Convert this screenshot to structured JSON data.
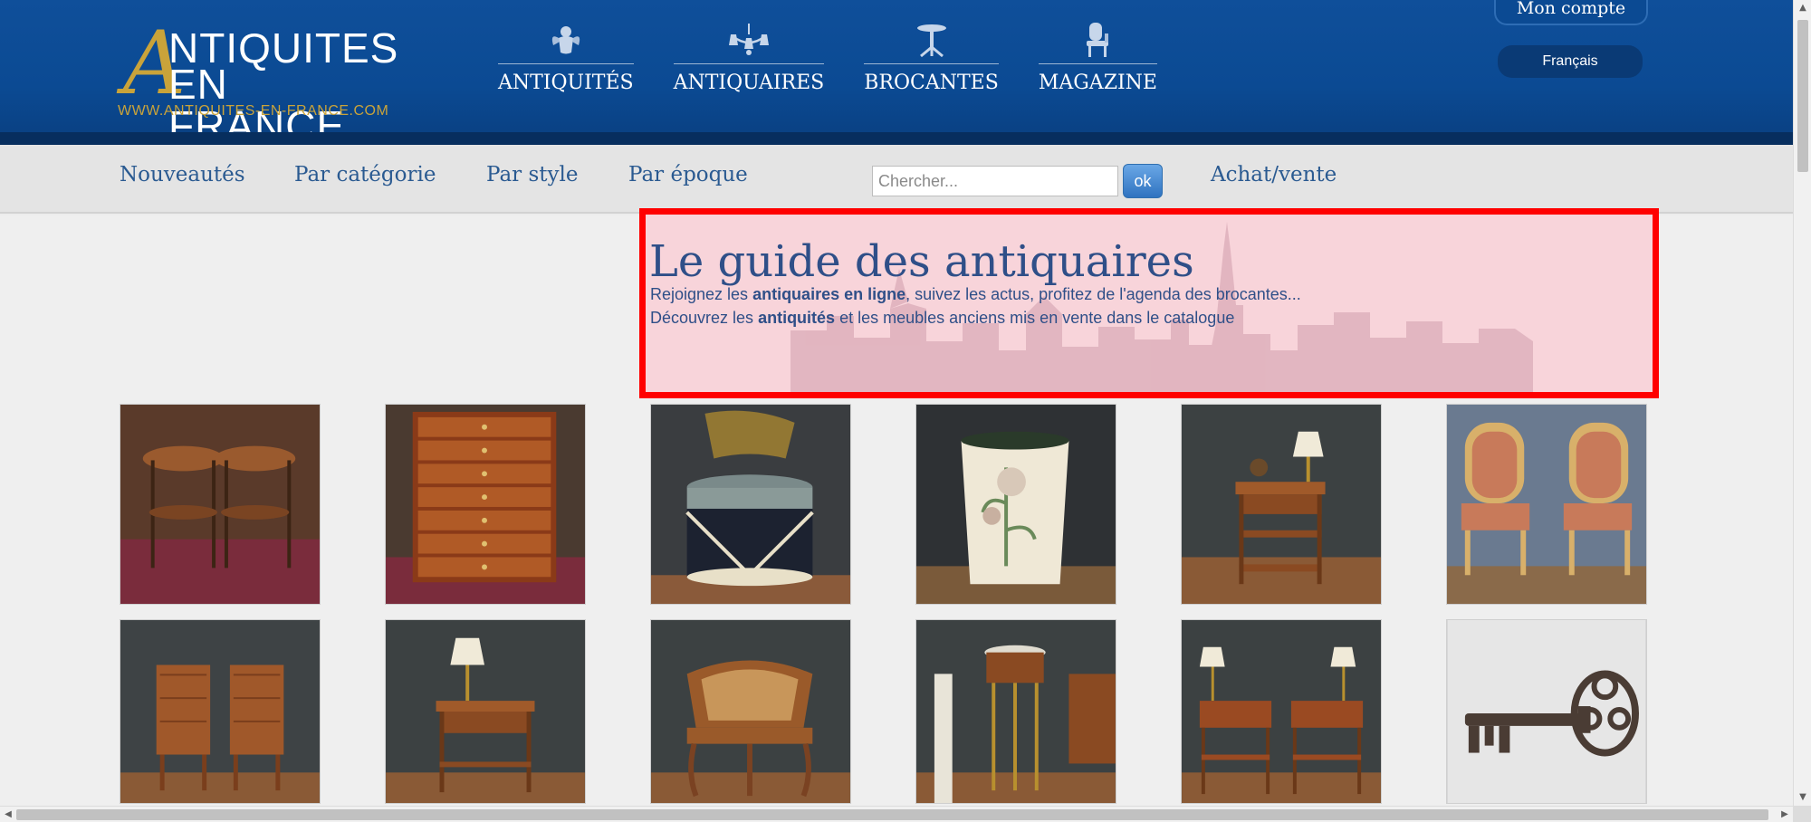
{
  "header": {
    "logo": {
      "letter": "A",
      "line1": "NTIQUITES",
      "line2": "EN FRANCE",
      "url": "WWW.ANTIQUITES-EN-FRANCE.COM"
    },
    "nav": [
      {
        "label": "ANTIQUITÉS",
        "icon": "cherub-icon"
      },
      {
        "label": "ANTIQUAIRES",
        "icon": "chandelier-icon"
      },
      {
        "label": "BROCANTES",
        "icon": "pedestal-table-icon"
      },
      {
        "label": "MAGAZINE",
        "icon": "chair-icon"
      }
    ],
    "account_label": "Mon compte",
    "language_label": "Français"
  },
  "subnav": {
    "links": [
      "Nouveautés",
      "Par catégorie",
      "Par style",
      "Par époque"
    ],
    "search_placeholder": "Chercher...",
    "search_button": "ok",
    "trade_link": "Achat/vente"
  },
  "hero": {
    "title": "Le guide des antiquaires",
    "line1_before": "Rejoignez les ",
    "line1_bold": "antiquaires en ligne",
    "line1_after": ", suivez les actus, profitez de l'agenda des brocantes...",
    "line2_before": "Découvrez les ",
    "line2_bold": "antiquités",
    "line2_after": " et les meubles anciens mis en vente dans le catalogue"
  },
  "products": [
    {
      "name": "pair-of-round-side-tables"
    },
    {
      "name": "marquetry-chest-of-drawers"
    },
    {
      "name": "drum-shaped-cabinet"
    },
    {
      "name": "floral-waste-basket"
    },
    {
      "name": "walnut-nightstand-with-lamp"
    },
    {
      "name": "pair-of-louis-xvi-armchairs"
    },
    {
      "name": "pair-of-cherry-chiffoniers"
    },
    {
      "name": "side-table-with-lamp"
    },
    {
      "name": "cane-corner-armchair"
    },
    {
      "name": "round-pedestal-side-table"
    },
    {
      "name": "pair-of-bedside-tables"
    },
    {
      "name": "antique-wrought-iron-key"
    }
  ],
  "colors": {
    "header_blue": "#0b4a93",
    "gold": "#c9a33a",
    "link_blue": "#2a5a91",
    "highlight_red": "#ff0000"
  }
}
